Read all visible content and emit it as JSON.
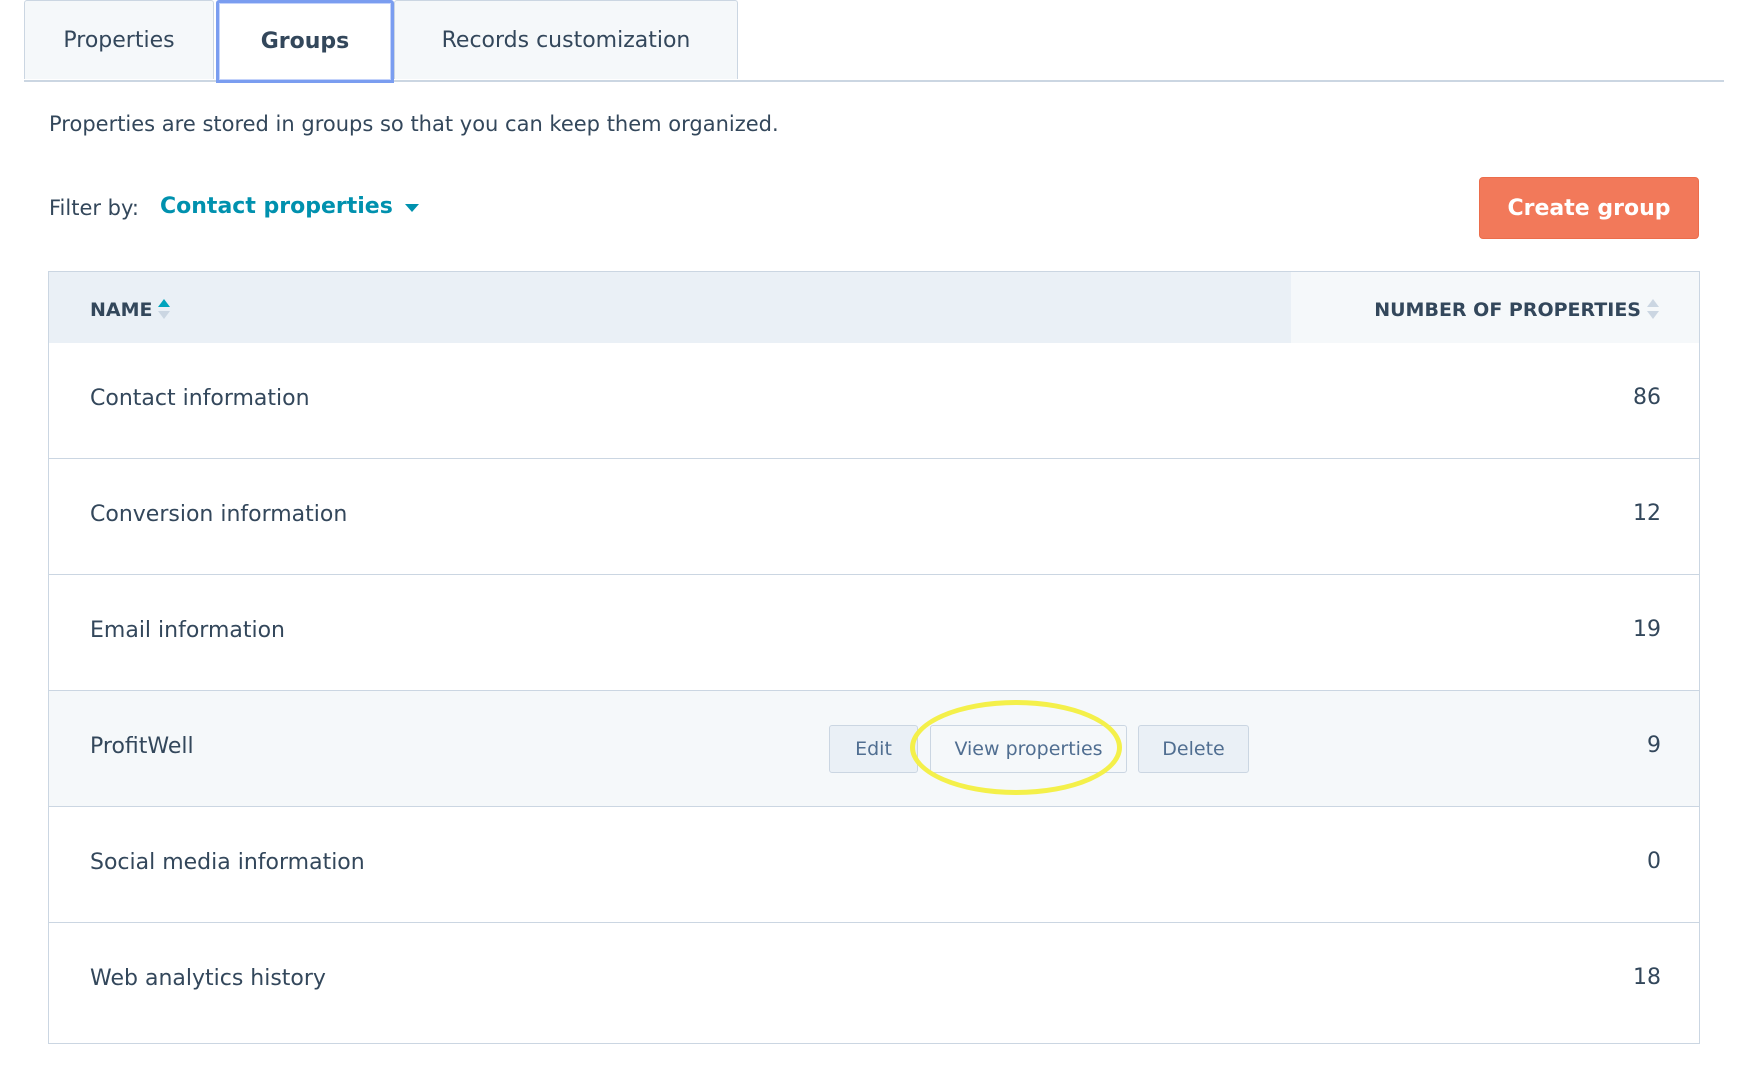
{
  "tabs": [
    {
      "label": "Properties"
    },
    {
      "label": "Groups"
    },
    {
      "label": "Records customization"
    }
  ],
  "description": "Properties are stored in groups so that you can keep them organized.",
  "filter": {
    "label": "Filter by:",
    "selected": "Contact properties"
  },
  "create_button": "Create group",
  "table": {
    "columns": {
      "name": "NAME",
      "count": "NUMBER OF PROPERTIES"
    },
    "rows": [
      {
        "name": "Contact information",
        "count": "86"
      },
      {
        "name": "Conversion information",
        "count": "12"
      },
      {
        "name": "Email information",
        "count": "19"
      },
      {
        "name": "ProfitWell",
        "count": "9"
      },
      {
        "name": "Social media information",
        "count": "0"
      },
      {
        "name": "Web analytics history",
        "count": "18"
      }
    ],
    "row_actions": {
      "edit": "Edit",
      "view": "View properties",
      "delete": "Delete"
    }
  },
  "colors": {
    "accent_link": "#0091ae",
    "primary_button": "#f2795a",
    "highlight": "#f4f04a",
    "active_tab_border": "#7a9df0"
  }
}
